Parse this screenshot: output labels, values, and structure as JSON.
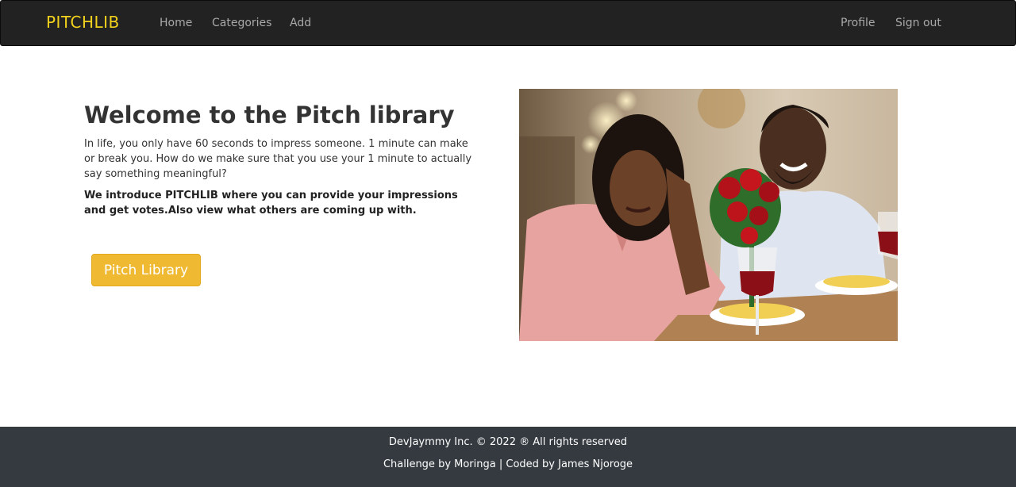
{
  "navbar": {
    "brand": "PITCHLIB",
    "links": [
      "Home",
      "Categories",
      "Add"
    ],
    "right_links": [
      "Profile",
      "Sign out"
    ]
  },
  "hero": {
    "title": "Welcome to the Pitch library",
    "paragraph": "In life, you only have 60 seconds to impress someone. 1 minute can make or break you. How do we make sure that you use your 1 minute to actually say something meaningful?",
    "strong_text": "We introduce PITCHLIB where you can provide your impressions and get votes.Also view what others are coming up with.",
    "button_label": "Pitch Library"
  },
  "image": {
    "subject": "couple-dinner-photo"
  },
  "footer": {
    "line1": "DevJaymmy Inc. © 2022 ® All rights reserved",
    "line2": "Challenge by Moringa | Coded by James Njoroge"
  },
  "colors": {
    "navbar_bg": "#222222",
    "brand": "#f2d21c",
    "nav_link": "#a9a9a9",
    "button_bg": "#efb932",
    "footer_bg": "#343a40"
  }
}
